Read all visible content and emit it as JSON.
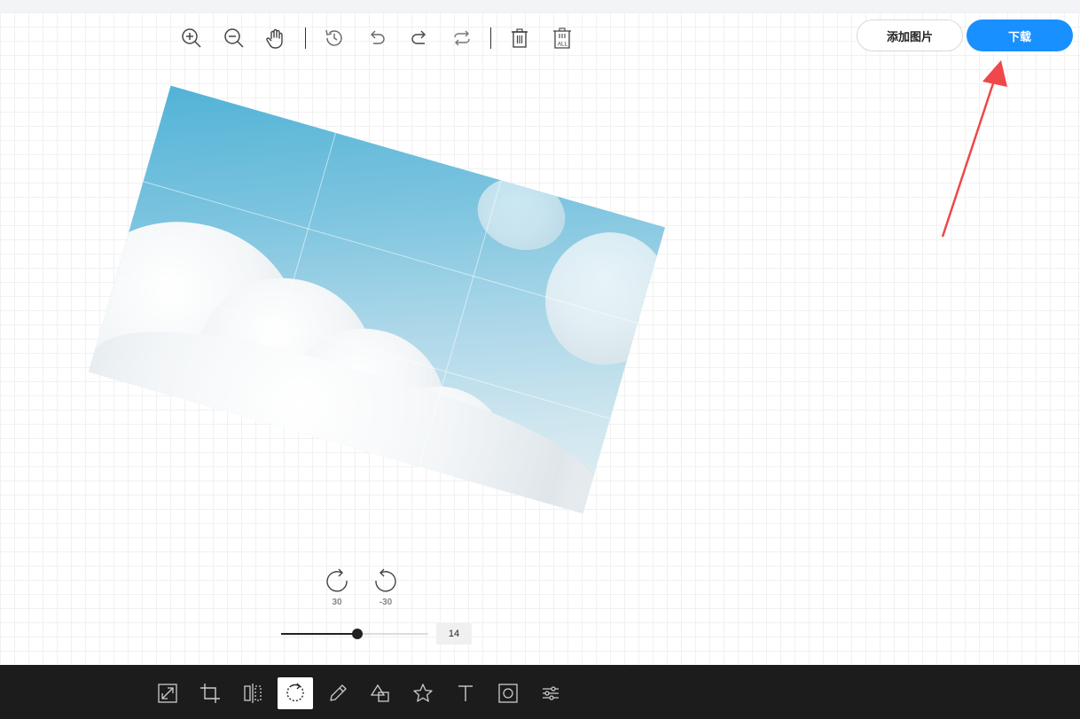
{
  "header": {
    "add_image_label": "添加图片",
    "download_label": "下载"
  },
  "toolbar_top": {
    "items": [
      {
        "name": "zoom-in",
        "icon": "zoom-in-icon"
      },
      {
        "name": "zoom-out",
        "icon": "zoom-out-icon"
      },
      {
        "name": "pan",
        "icon": "hand-icon"
      },
      {
        "name": "history",
        "icon": "history-icon"
      },
      {
        "name": "undo",
        "icon": "undo-icon"
      },
      {
        "name": "redo",
        "icon": "redo-icon"
      },
      {
        "name": "reset",
        "icon": "reset-icon"
      },
      {
        "name": "delete",
        "icon": "trash-icon"
      },
      {
        "name": "delete-all",
        "icon": "trash-all-icon",
        "label": "ALL"
      }
    ]
  },
  "rotate_panel": {
    "clockwise_label": "30",
    "counter_clockwise_label": "-30"
  },
  "slider": {
    "value": "14",
    "fraction": 0.52
  },
  "bottom_toolbar": {
    "active": "rotate",
    "items": [
      {
        "name": "resize",
        "icon": "resize-icon"
      },
      {
        "name": "crop",
        "icon": "crop-icon"
      },
      {
        "name": "flip",
        "icon": "flip-icon"
      },
      {
        "name": "rotate",
        "icon": "rotate-icon"
      },
      {
        "name": "draw",
        "icon": "pencil-icon"
      },
      {
        "name": "shape",
        "icon": "shape-icon"
      },
      {
        "name": "icon",
        "icon": "star-icon"
      },
      {
        "name": "text",
        "icon": "text-icon"
      },
      {
        "name": "mask",
        "icon": "mask-icon"
      },
      {
        "name": "filter",
        "icon": "sliders-icon"
      }
    ]
  },
  "colors": {
    "accent": "#1890ff",
    "annotation_arrow": "#f0474a",
    "bottombar_bg": "#1c1c1c"
  }
}
